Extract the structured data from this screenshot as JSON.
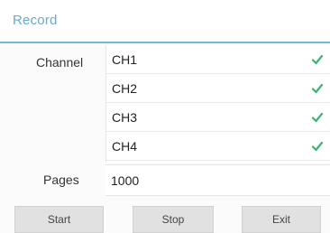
{
  "window": {
    "title": "Record"
  },
  "form": {
    "channel_label": "Channel",
    "channels": [
      {
        "label": "CH1",
        "checked": true
      },
      {
        "label": "CH2",
        "checked": true
      },
      {
        "label": "CH3",
        "checked": true
      },
      {
        "label": "CH4",
        "checked": true
      }
    ],
    "pages_label": "Pages",
    "pages_value": "1000"
  },
  "buttons": {
    "start": "Start",
    "stop": "Stop",
    "exit": "Exit"
  },
  "colors": {
    "accent": "#6fb9d9",
    "title_text": "#6aa9d3",
    "check": "#3cb371"
  },
  "icons": {
    "checkbox": "checkmark-icon"
  }
}
